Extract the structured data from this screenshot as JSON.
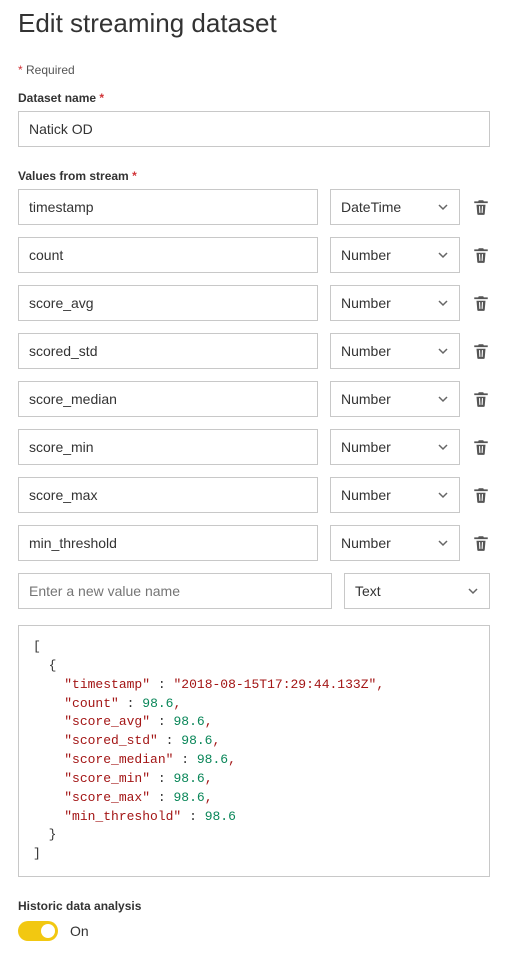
{
  "header": {
    "title": "Edit streaming dataset"
  },
  "required_note": {
    "star": "*",
    "text": "Required"
  },
  "dataset_name": {
    "label": "Dataset name",
    "star": "*",
    "value": "Natick OD"
  },
  "values_section": {
    "label": "Values from stream",
    "star": "*",
    "fields": [
      {
        "name": "timestamp",
        "type": "DateTime"
      },
      {
        "name": "count",
        "type": "Number"
      },
      {
        "name": "score_avg",
        "type": "Number"
      },
      {
        "name": "scored_std",
        "type": "Number"
      },
      {
        "name": "score_median",
        "type": "Number"
      },
      {
        "name": "score_min",
        "type": "Number"
      },
      {
        "name": "score_max",
        "type": "Number"
      },
      {
        "name": "min_threshold",
        "type": "Number"
      }
    ],
    "new_field": {
      "placeholder": "Enter a new value name",
      "type": "Text"
    }
  },
  "json_preview": {
    "timestamp": "2018-08-15T17:29:44.133Z",
    "count": 98.6,
    "score_avg": 98.6,
    "scored_std": 98.6,
    "score_median": 98.6,
    "score_min": 98.6,
    "score_max": 98.6,
    "min_threshold": 98.6
  },
  "historic": {
    "label": "Historic data analysis",
    "state_label": "On",
    "on": true
  }
}
